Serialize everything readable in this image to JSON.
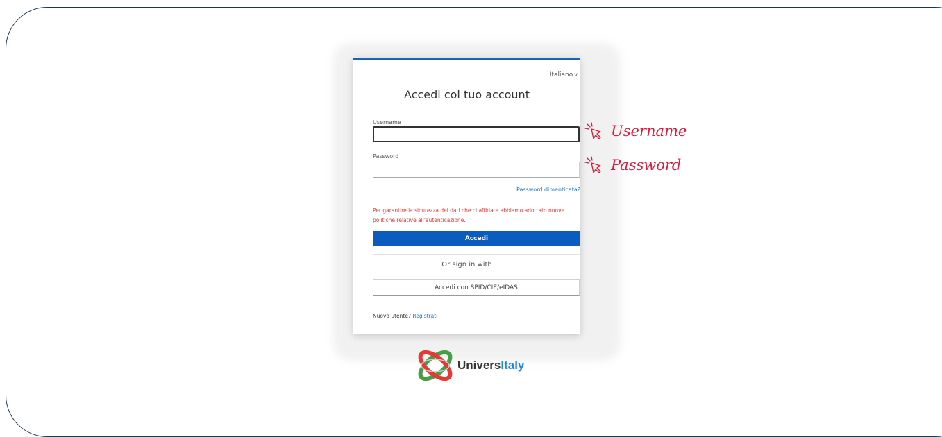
{
  "login": {
    "language": "Italiano",
    "title": "Accedi col tuo account",
    "username_label": "Username",
    "username_value": "",
    "password_label": "Password",
    "password_value": "",
    "forgot_password": "Password dimenticata?",
    "security_notice": "Per garantire la sicurezza dei dati che ci affidate abbiamo adottato nuove politiche relative all'autenticazione.",
    "submit_label": "Accedi",
    "or_sign_in_with": "Or sign in with",
    "spid_button": "Accedi con SPID/CIE/eIDAS",
    "new_user_text": "Nuovo utente?",
    "register_link": "Registrati"
  },
  "annotations": {
    "username": "Username",
    "password": "Password",
    "color": "#d81b3c"
  },
  "logo": {
    "part1": "Univers",
    "part2": "Italy"
  },
  "colors": {
    "primary": "#0b5cbf",
    "link": "#1a73c8",
    "warning": "#e53935"
  }
}
